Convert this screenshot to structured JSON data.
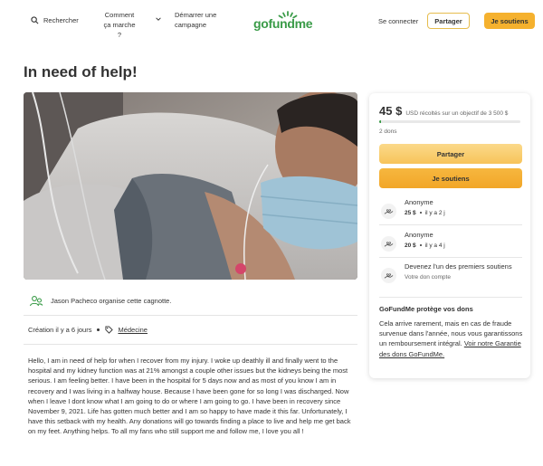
{
  "header": {
    "search_label": "Rechercher",
    "how_it_works": "Comment ça marche ?",
    "start_campaign": "Démarrer une campagne",
    "logo": "gofundme",
    "login": "Se connecter",
    "share": "Partager",
    "donate": "Je soutiens"
  },
  "page": {
    "title": "In need of help!"
  },
  "organizer": {
    "text": "Jason Pacheco organise cette cagnotte."
  },
  "meta": {
    "created": "Création il y a 6 jours",
    "category": "Médecine"
  },
  "story": "Hello, I am in need of help for when I recover from my injury. I woke up deathly ill and finally went to the hospital and my kidney function was at 21% amongst a couple other issues but the kidneys being the most serious. I am feeling better. I have been in the hospital for 5 days now and as most of you know I am in recovery and I was living in a halfway house. Because I have been gone for so long I was discharged. Now when I leave I dont know what I am going to do or where I am going to go. I have been in recovery since November 9, 2021. Life has gotten much better and I am so happy to have made it this far. Unfortunately, I have this setback with my health. Any donations will go towards finding a place to live and help me get back on my feet. Anything helps. To all my fans who still support me and follow me, I love you all !",
  "sidebar": {
    "amount": "45 $",
    "goal_text": "USD récoltés sur un objectif de 3 500 $",
    "progress_fraction": 0.013,
    "donations_count": "2 dons",
    "share_button": "Partager",
    "donate_button": "Je soutiens",
    "donors": [
      {
        "name": "Anonyme",
        "amount": "25 $",
        "time": "il y a 2 j"
      },
      {
        "name": "Anonyme",
        "amount": "20 $",
        "time": "il y a 4 j"
      }
    ],
    "first_donor": {
      "title": "Devenez l'un des premiers soutiens",
      "subtitle": "Votre don compte"
    }
  },
  "protection": {
    "title": "GoFundMe protège vos dons",
    "text": "Cela arrive rarement, mais en cas de fraude survenue dans l'année, nous vous garantissons un remboursement intégral.",
    "link": "Voir notre Garantie des dons GoFundMe."
  },
  "colors": {
    "brand_green": "#3a9b48",
    "accent_yellow": "#f5b12e"
  }
}
